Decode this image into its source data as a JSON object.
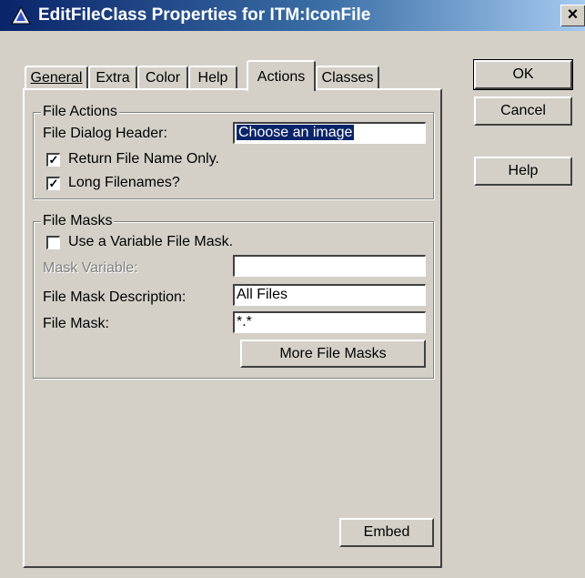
{
  "window": {
    "title": "EditFileClass Properties for ITM:IconFile",
    "close_glyph": "×"
  },
  "tabs": [
    {
      "label": "General"
    },
    {
      "label": "Extra"
    },
    {
      "label": "Color"
    },
    {
      "label": "Help"
    },
    {
      "label": "Actions"
    },
    {
      "label": "Classes"
    }
  ],
  "file_actions": {
    "legend": "File Actions",
    "dialog_header_label": "File Dialog Header:",
    "dialog_header_value": "Choose an image",
    "return_filename_only": {
      "label": "Return File Name Only.",
      "checked": true
    },
    "long_filenames": {
      "label": "Long Filenames?",
      "checked": true
    }
  },
  "file_masks": {
    "legend": "File Masks",
    "use_variable_mask": {
      "label": "Use a Variable File Mask.",
      "checked": false
    },
    "mask_variable_label": "Mask Variable:",
    "mask_variable_value": "",
    "mask_description_label": "File Mask Description:",
    "mask_description_value": "All Files",
    "file_mask_label": "File Mask:",
    "file_mask_value": "*.*",
    "more_masks_button": "More File Masks"
  },
  "buttons": {
    "ok": "OK",
    "cancel": "Cancel",
    "help": "Help",
    "embed": "Embed"
  },
  "colors": {
    "title_start": "#0a246a",
    "title_end": "#a6caf0",
    "face": "#d4d0c8",
    "selection": "#0a246a"
  }
}
